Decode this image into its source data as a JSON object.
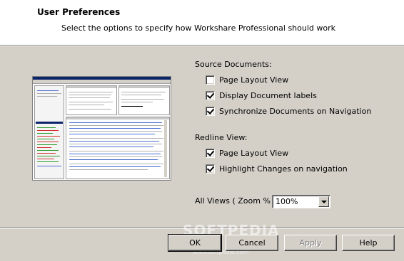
{
  "header": {
    "title": "User Preferences",
    "subtitle": "Select the options to specify how Workshare Professional should work"
  },
  "source_documents": {
    "label": "Source Documents:",
    "options": [
      {
        "label": "Page Layout View",
        "checked": false
      },
      {
        "label": "Display Document labels",
        "checked": true
      },
      {
        "label": "Synchronize Documents on Navigation",
        "checked": true
      }
    ]
  },
  "redline_view": {
    "label": "Redline View:",
    "options": [
      {
        "label": "Page Layout View",
        "checked": true
      },
      {
        "label": "Highlight Changes on navigation",
        "checked": true
      }
    ]
  },
  "zoom": {
    "label": "All Views ( Zoom % ):",
    "value": "100%"
  },
  "buttons": {
    "ok": "OK",
    "cancel": "Cancel",
    "apply": "Apply",
    "help": "Help"
  },
  "watermark": {
    "text": "SOFTPEDIA",
    "url": "www.softpedia.com"
  }
}
